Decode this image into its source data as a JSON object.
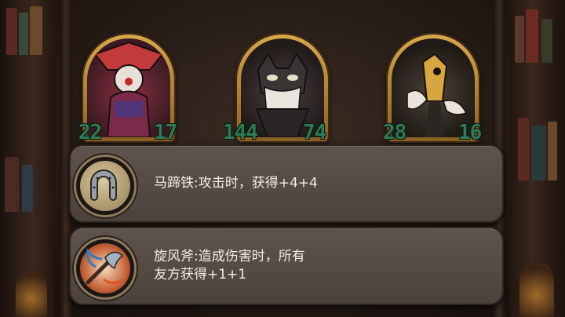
{
  "cards": [
    {
      "name": "clown",
      "attack": "22",
      "health": "17"
    },
    {
      "name": "cat",
      "attack": "144",
      "health": "74"
    },
    {
      "name": "bird",
      "attack": "28",
      "health": "16"
    }
  ],
  "tooltips": [
    {
      "icon": "horseshoe-icon",
      "text": "马蹄铁:攻击时，获得+4+4"
    },
    {
      "icon": "axe-icon",
      "line1": "旋风斧:造成伤害时，所有",
      "line2": "友方获得+1+1"
    }
  ]
}
